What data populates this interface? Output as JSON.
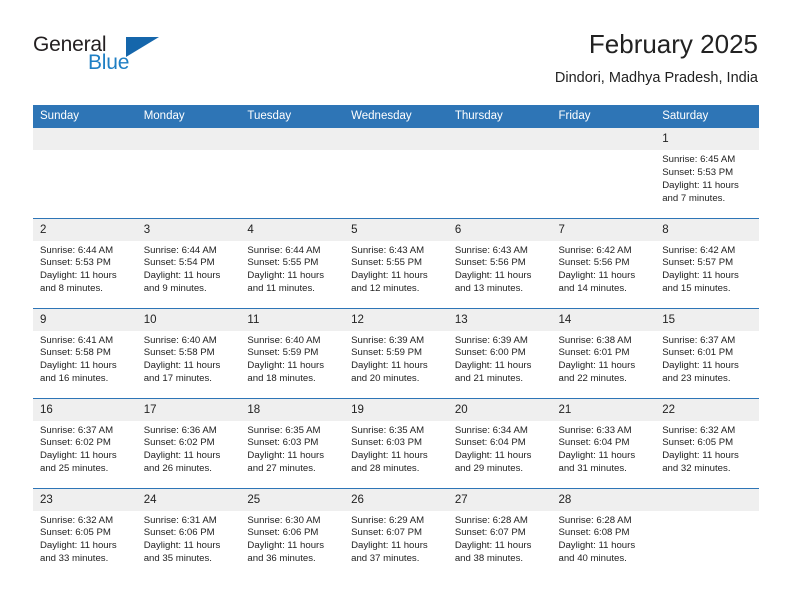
{
  "brand": {
    "word_one": "General",
    "word_two": "Blue",
    "triangle_icon": "triangle-icon",
    "accent_color": "#1f7fc4",
    "header_color": "#2e75b6"
  },
  "header": {
    "title": "February 2025",
    "subtitle": "Dindori, Madhya Pradesh, India"
  },
  "calendar": {
    "weekday_headers": [
      "Sunday",
      "Monday",
      "Tuesday",
      "Wednesday",
      "Thursday",
      "Friday",
      "Saturday"
    ],
    "weeks": [
      [
        {
          "day": "",
          "empty": true
        },
        {
          "day": "",
          "empty": true
        },
        {
          "day": "",
          "empty": true
        },
        {
          "day": "",
          "empty": true
        },
        {
          "day": "",
          "empty": true
        },
        {
          "day": "",
          "empty": true
        },
        {
          "day": "1",
          "sunrise": "Sunrise: 6:45 AM",
          "sunset": "Sunset: 5:53 PM",
          "daylight": "Daylight: 11 hours and 7 minutes."
        }
      ],
      [
        {
          "day": "2",
          "sunrise": "Sunrise: 6:44 AM",
          "sunset": "Sunset: 5:53 PM",
          "daylight": "Daylight: 11 hours and 8 minutes."
        },
        {
          "day": "3",
          "sunrise": "Sunrise: 6:44 AM",
          "sunset": "Sunset: 5:54 PM",
          "daylight": "Daylight: 11 hours and 9 minutes."
        },
        {
          "day": "4",
          "sunrise": "Sunrise: 6:44 AM",
          "sunset": "Sunset: 5:55 PM",
          "daylight": "Daylight: 11 hours and 11 minutes."
        },
        {
          "day": "5",
          "sunrise": "Sunrise: 6:43 AM",
          "sunset": "Sunset: 5:55 PM",
          "daylight": "Daylight: 11 hours and 12 minutes."
        },
        {
          "day": "6",
          "sunrise": "Sunrise: 6:43 AM",
          "sunset": "Sunset: 5:56 PM",
          "daylight": "Daylight: 11 hours and 13 minutes."
        },
        {
          "day": "7",
          "sunrise": "Sunrise: 6:42 AM",
          "sunset": "Sunset: 5:56 PM",
          "daylight": "Daylight: 11 hours and 14 minutes."
        },
        {
          "day": "8",
          "sunrise": "Sunrise: 6:42 AM",
          "sunset": "Sunset: 5:57 PM",
          "daylight": "Daylight: 11 hours and 15 minutes."
        }
      ],
      [
        {
          "day": "9",
          "sunrise": "Sunrise: 6:41 AM",
          "sunset": "Sunset: 5:58 PM",
          "daylight": "Daylight: 11 hours and 16 minutes."
        },
        {
          "day": "10",
          "sunrise": "Sunrise: 6:40 AM",
          "sunset": "Sunset: 5:58 PM",
          "daylight": "Daylight: 11 hours and 17 minutes."
        },
        {
          "day": "11",
          "sunrise": "Sunrise: 6:40 AM",
          "sunset": "Sunset: 5:59 PM",
          "daylight": "Daylight: 11 hours and 18 minutes."
        },
        {
          "day": "12",
          "sunrise": "Sunrise: 6:39 AM",
          "sunset": "Sunset: 5:59 PM",
          "daylight": "Daylight: 11 hours and 20 minutes."
        },
        {
          "day": "13",
          "sunrise": "Sunrise: 6:39 AM",
          "sunset": "Sunset: 6:00 PM",
          "daylight": "Daylight: 11 hours and 21 minutes."
        },
        {
          "day": "14",
          "sunrise": "Sunrise: 6:38 AM",
          "sunset": "Sunset: 6:01 PM",
          "daylight": "Daylight: 11 hours and 22 minutes."
        },
        {
          "day": "15",
          "sunrise": "Sunrise: 6:37 AM",
          "sunset": "Sunset: 6:01 PM",
          "daylight": "Daylight: 11 hours and 23 minutes."
        }
      ],
      [
        {
          "day": "16",
          "sunrise": "Sunrise: 6:37 AM",
          "sunset": "Sunset: 6:02 PM",
          "daylight": "Daylight: 11 hours and 25 minutes."
        },
        {
          "day": "17",
          "sunrise": "Sunrise: 6:36 AM",
          "sunset": "Sunset: 6:02 PM",
          "daylight": "Daylight: 11 hours and 26 minutes."
        },
        {
          "day": "18",
          "sunrise": "Sunrise: 6:35 AM",
          "sunset": "Sunset: 6:03 PM",
          "daylight": "Daylight: 11 hours and 27 minutes."
        },
        {
          "day": "19",
          "sunrise": "Sunrise: 6:35 AM",
          "sunset": "Sunset: 6:03 PM",
          "daylight": "Daylight: 11 hours and 28 minutes."
        },
        {
          "day": "20",
          "sunrise": "Sunrise: 6:34 AM",
          "sunset": "Sunset: 6:04 PM",
          "daylight": "Daylight: 11 hours and 29 minutes."
        },
        {
          "day": "21",
          "sunrise": "Sunrise: 6:33 AM",
          "sunset": "Sunset: 6:04 PM",
          "daylight": "Daylight: 11 hours and 31 minutes."
        },
        {
          "day": "22",
          "sunrise": "Sunrise: 6:32 AM",
          "sunset": "Sunset: 6:05 PM",
          "daylight": "Daylight: 11 hours and 32 minutes."
        }
      ],
      [
        {
          "day": "23",
          "sunrise": "Sunrise: 6:32 AM",
          "sunset": "Sunset: 6:05 PM",
          "daylight": "Daylight: 11 hours and 33 minutes."
        },
        {
          "day": "24",
          "sunrise": "Sunrise: 6:31 AM",
          "sunset": "Sunset: 6:06 PM",
          "daylight": "Daylight: 11 hours and 35 minutes."
        },
        {
          "day": "25",
          "sunrise": "Sunrise: 6:30 AM",
          "sunset": "Sunset: 6:06 PM",
          "daylight": "Daylight: 11 hours and 36 minutes."
        },
        {
          "day": "26",
          "sunrise": "Sunrise: 6:29 AM",
          "sunset": "Sunset: 6:07 PM",
          "daylight": "Daylight: 11 hours and 37 minutes."
        },
        {
          "day": "27",
          "sunrise": "Sunrise: 6:28 AM",
          "sunset": "Sunset: 6:07 PM",
          "daylight": "Daylight: 11 hours and 38 minutes."
        },
        {
          "day": "28",
          "sunrise": "Sunrise: 6:28 AM",
          "sunset": "Sunset: 6:08 PM",
          "daylight": "Daylight: 11 hours and 40 minutes."
        },
        {
          "day": "",
          "empty": true
        }
      ]
    ]
  }
}
